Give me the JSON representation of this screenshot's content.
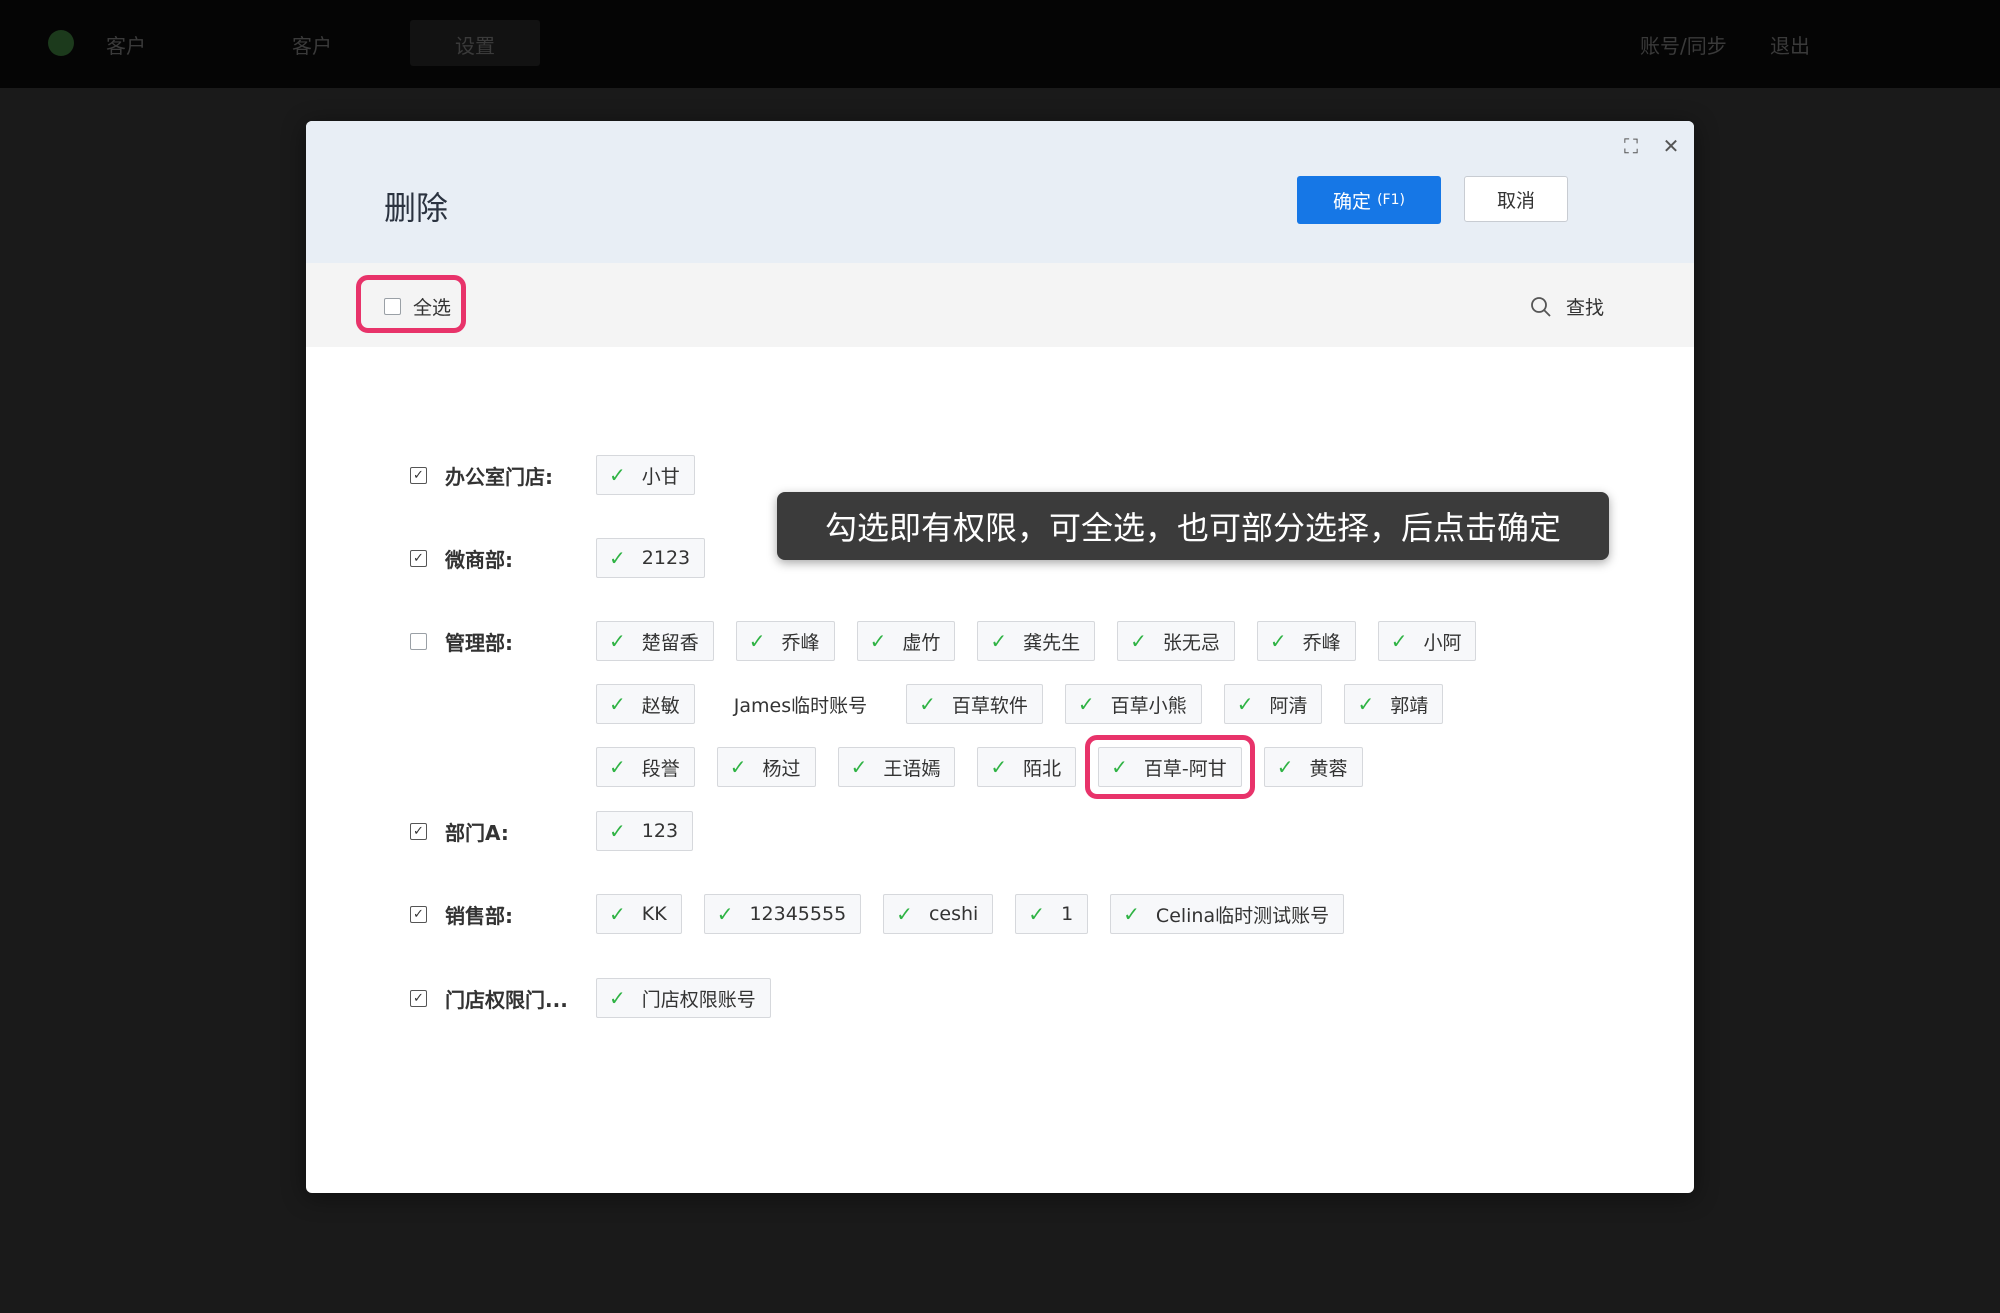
{
  "topbar": {
    "item1": "客户",
    "item2": "客户",
    "item3": "设置",
    "right1": "账号/同步",
    "right2": "退出"
  },
  "modal": {
    "title": "删除",
    "confirm_label": "确定",
    "confirm_hotkey": "(F1)",
    "cancel_label": "取消",
    "select_all_label": "全选",
    "search_label": "查找"
  },
  "tooltip": "勾选即有权限，可全选，也可部分选择，后点击确定",
  "groups": [
    {
      "label": "办公室门店:",
      "checked": true,
      "members": [
        {
          "name": "小甘",
          "checked": true
        }
      ]
    },
    {
      "label": "微商部:",
      "checked": true,
      "members": [
        {
          "name": "2123",
          "checked": true
        }
      ]
    },
    {
      "label": "管理部:",
      "checked": false,
      "members": [
        {
          "name": "楚留香",
          "checked": true
        },
        {
          "name": "乔峰",
          "checked": true
        },
        {
          "name": "虚竹",
          "checked": true
        },
        {
          "name": "龚先生",
          "checked": true
        },
        {
          "name": "张无忌",
          "checked": true
        },
        {
          "name": "乔峰",
          "checked": true
        },
        {
          "name": "小阿",
          "checked": true
        },
        {
          "name": "赵敏",
          "checked": true
        },
        {
          "name": "James临时账号",
          "checked": false
        },
        {
          "name": "百草软件",
          "checked": true
        },
        {
          "name": "百草小熊",
          "checked": true
        },
        {
          "name": "阿清",
          "checked": true
        },
        {
          "name": "郭靖",
          "checked": true
        },
        {
          "name": "段誉",
          "checked": true
        },
        {
          "name": "杨过",
          "checked": true
        },
        {
          "name": "王语嫣",
          "checked": true
        },
        {
          "name": "陌北",
          "checked": true
        },
        {
          "name": "百草-阿甘",
          "checked": true,
          "highlighted": true
        },
        {
          "name": "黄蓉",
          "checked": true
        }
      ]
    },
    {
      "label": "部门A:",
      "checked": true,
      "members": [
        {
          "name": "123",
          "checked": true
        }
      ]
    },
    {
      "label": "销售部:",
      "checked": true,
      "members": [
        {
          "name": "KK",
          "checked": true
        },
        {
          "name": "12345555",
          "checked": true
        },
        {
          "name": "ceshi",
          "checked": true
        },
        {
          "name": "1",
          "checked": true
        },
        {
          "name": "Celina临时测试账号",
          "checked": true
        }
      ]
    },
    {
      "label": "门店权限门...",
      "checked": true,
      "members": [
        {
          "name": "门店权限账号",
          "checked": true
        }
      ]
    }
  ],
  "colors": {
    "primary": "#1677e6",
    "check": "#2fb344",
    "highlight": "#e8336a"
  }
}
